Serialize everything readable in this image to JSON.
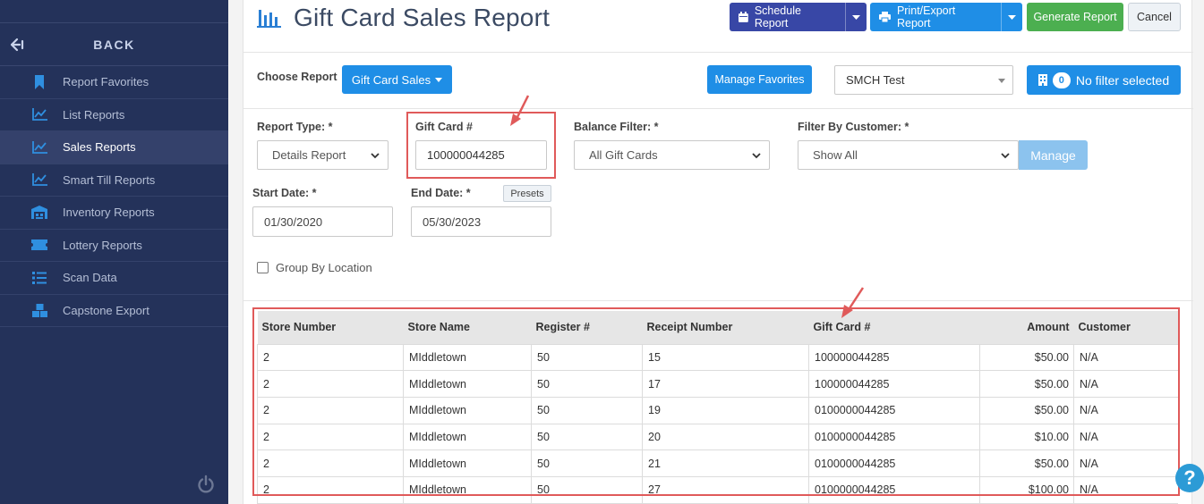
{
  "sidebar": {
    "back_label": "BACK",
    "items": [
      {
        "label": "Report Favorites",
        "icon": "bookmark-icon"
      },
      {
        "label": "List Reports",
        "icon": "line-chart-icon"
      },
      {
        "label": "Sales Reports",
        "icon": "line-chart-icon",
        "active": true
      },
      {
        "label": "Smart Till Reports",
        "icon": "line-chart-icon"
      },
      {
        "label": "Inventory Reports",
        "icon": "warehouse-icon"
      },
      {
        "label": "Lottery Reports",
        "icon": "ticket-icon"
      },
      {
        "label": "Scan Data",
        "icon": "list-icon"
      },
      {
        "label": "Capstone Export",
        "icon": "boxes-icon"
      }
    ]
  },
  "header": {
    "title": "Gift Card Sales Report",
    "schedule_label": "Schedule Report",
    "print_label": "Print/Export Report",
    "generate_label": "Generate Report",
    "cancel_label": "Cancel"
  },
  "choose": {
    "label": "Choose Report",
    "report_button": "Gift Card Sales",
    "manage_favorites": "Manage Favorites",
    "location_select": "SMCH Test",
    "filter_count": "0",
    "filter_label": "No filter selected"
  },
  "filters": {
    "report_type_label": "Report Type: *",
    "report_type_value": "Details Report",
    "gift_card_label": "Gift Card #",
    "gift_card_value": "100000044285",
    "balance_label": "Balance Filter: *",
    "balance_value": "All Gift Cards",
    "customer_label": "Filter By Customer: *",
    "customer_value": "Show All",
    "manage_label": "Manage",
    "start_label": "Start Date: *",
    "start_value": "01/30/2020",
    "end_label": "End Date: *",
    "end_value": "05/30/2023",
    "presets_label": "Presets",
    "group_by_label": "Group By Location"
  },
  "table": {
    "headers": [
      "Store Number",
      "Store Name",
      "Register #",
      "Receipt Number",
      "Gift Card #",
      "Amount",
      "Customer"
    ],
    "rows": [
      [
        "2",
        "MIddletown",
        "50",
        "15",
        "100000044285",
        "$50.00",
        "N/A"
      ],
      [
        "2",
        "MIddletown",
        "50",
        "17",
        "100000044285",
        "$50.00",
        "N/A"
      ],
      [
        "2",
        "MIddletown",
        "50",
        "19",
        "0100000044285",
        "$50.00",
        "N/A"
      ],
      [
        "2",
        "MIddletown",
        "50",
        "20",
        "0100000044285",
        "$10.00",
        "N/A"
      ],
      [
        "2",
        "MIddletown",
        "50",
        "21",
        "0100000044285",
        "$50.00",
        "N/A"
      ],
      [
        "2",
        "MIddletown",
        "50",
        "27",
        "0100000044285",
        "$100.00",
        "N/A"
      ]
    ]
  },
  "colors": {
    "sidebar_bg": "#24325a",
    "primary": "#1f8ee6",
    "schedule": "#3847a6",
    "generate": "#4caf50",
    "annotation": "#e05a5a"
  }
}
